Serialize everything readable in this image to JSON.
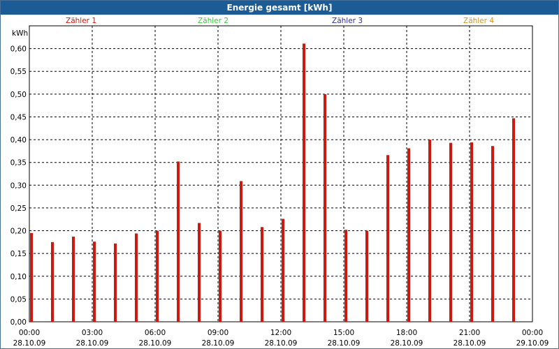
{
  "window": {
    "title": "Energie gesamt [kWh]"
  },
  "colors": {
    "titlebar": "#1b5c96",
    "bars": "#cc1a0f",
    "grid": "#000000"
  },
  "legend": [
    {
      "name": "Zähler 1",
      "color": "#cc1a0f"
    },
    {
      "name": "Zähler 2",
      "color": "#33cc33"
    },
    {
      "name": "Zähler 3",
      "color": "#2a2ab0"
    },
    {
      "name": "Zähler 4",
      "color": "#d9931a"
    }
  ],
  "chart_data": {
    "type": "bar",
    "title": "Energie gesamt [kWh]",
    "ylabel": "kWh",
    "ylim": [
      0,
      0.65
    ],
    "yticks": [
      "0,00",
      "0,05",
      "0,10",
      "0,15",
      "0,20",
      "0,25",
      "0,30",
      "0,35",
      "0,40",
      "0,45",
      "0,50",
      "0,55",
      "0,60"
    ],
    "xlim_hours": [
      0,
      24
    ],
    "xticks": [
      {
        "time": "00:00",
        "date": "28.10.09"
      },
      {
        "time": "03:00",
        "date": "28.10.09"
      },
      {
        "time": "06:00",
        "date": "28.10.09"
      },
      {
        "time": "09:00",
        "date": "28.10.09"
      },
      {
        "time": "12:00",
        "date": "28.10.09"
      },
      {
        "time": "15:00",
        "date": "28.10.09"
      },
      {
        "time": "18:00",
        "date": "28.10.09"
      },
      {
        "time": "21:00",
        "date": "28.10.09"
      },
      {
        "time": "00:00",
        "date": "29.10.09"
      }
    ],
    "grid": true,
    "legend_position": "top",
    "series": [
      {
        "name": "Zähler 1",
        "hours": [
          0,
          1,
          2,
          3,
          4,
          5,
          6,
          7,
          8,
          9,
          10,
          11,
          12,
          13,
          14,
          15,
          16,
          17,
          18,
          19,
          20,
          21,
          22,
          23
        ],
        "values": [
          0.195,
          0.175,
          0.187,
          0.176,
          0.172,
          0.194,
          0.2,
          0.352,
          0.217,
          0.2,
          0.309,
          0.208,
          0.226,
          0.611,
          0.5,
          0.202,
          0.2,
          0.366,
          0.381,
          0.4,
          0.393,
          0.394,
          0.386,
          0.447
        ]
      }
    ]
  }
}
